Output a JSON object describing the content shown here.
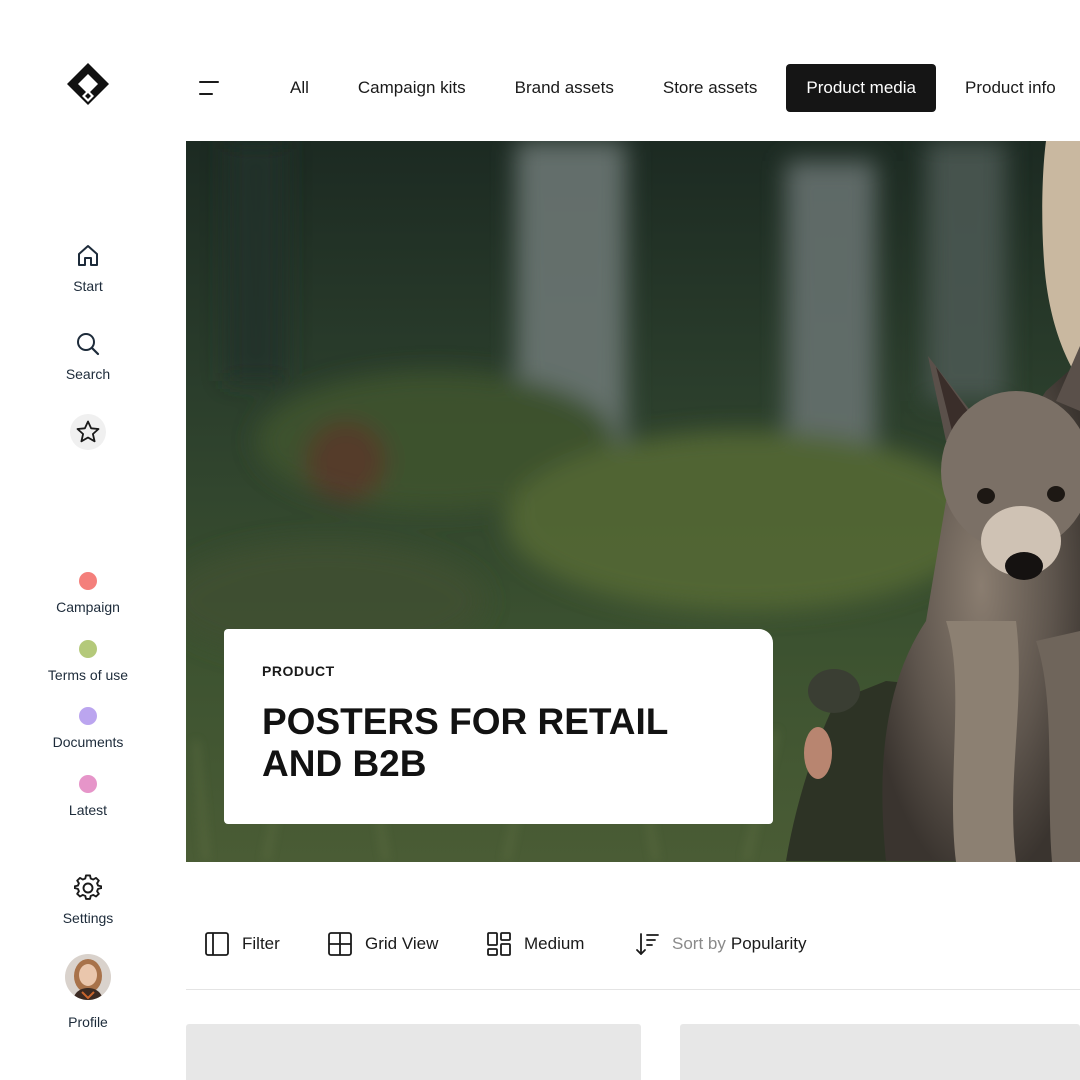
{
  "sidebar": {
    "logo": "brand-logo",
    "nav": [
      {
        "label": "Start",
        "icon": "home-icon"
      },
      {
        "label": "Search",
        "icon": "search-icon"
      }
    ],
    "favorites_icon": "star-icon",
    "categories": [
      {
        "label": "Campaign",
        "color": "#f47f7b"
      },
      {
        "label": "Terms of use",
        "color": "#b4c97a"
      },
      {
        "label": "Documents",
        "color": "#bba5ef"
      },
      {
        "label": "Latest",
        "color": "#e695c9"
      }
    ],
    "settings": {
      "label": "Settings",
      "icon": "gear-icon"
    },
    "profile": {
      "label": "Profile"
    }
  },
  "tabs": [
    "All",
    "Campaign kits",
    "Brand assets",
    "Store assets",
    "Product media",
    "Product info"
  ],
  "active_tab": "Product media",
  "hero": {
    "kicker": "PRODUCT",
    "title": "POSTERS FOR RETAIL AND B2B"
  },
  "toolbar": {
    "filter": "Filter",
    "view": "Grid View",
    "size": "Medium",
    "sort_prefix": "Sort by",
    "sort_value": "Popularity"
  }
}
